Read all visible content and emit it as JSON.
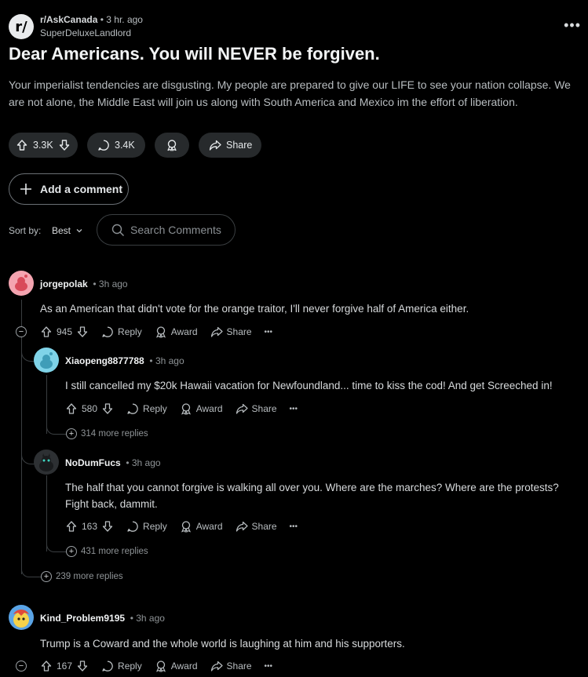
{
  "post": {
    "subreddit_avatar": "r/",
    "subreddit": "r/AskCanada",
    "time": "3 hr. ago",
    "author": "SuperDeluxeLandlord",
    "title": "Dear Americans. You will NEVER be forgiven.",
    "body": "Your imperialist tendencies are disgusting. My people are prepared to give our LIFE to see your nation collapse. We are not alone, the Middle East will join us along with South America and Mexico im the effort of liberation.",
    "votes": "3.3K",
    "comments": "3.4K",
    "share_label": "Share",
    "more_label": "•••"
  },
  "add_comment_label": "Add a comment",
  "sort": {
    "label": "Sort by:",
    "value": "Best"
  },
  "search": {
    "placeholder": "Search Comments"
  },
  "comments": [
    {
      "author": "jorgepolak",
      "time": "3h ago",
      "text": "As an American that didn't vote for the orange traitor, I'll never forgive half of America either.",
      "votes": "945",
      "reply_label": "Reply",
      "award_label": "Award",
      "share_label": "Share",
      "more_label": "•••",
      "replies": [
        {
          "author": "Xiaopeng8877788",
          "time": "3h ago",
          "text": "I still cancelled my $20k Hawaii vacation for Newfoundland... time to kiss the cod! And get Screeched in!",
          "votes": "580",
          "more_replies": "314 more replies"
        },
        {
          "author": "NoDumFucs",
          "time": "3h ago",
          "text": "The half that you cannot forgive is walking all over you. Where are the marches? Where are the protests? Fight back, dammit.",
          "votes": "163",
          "more_replies": "431 more replies"
        }
      ],
      "more_replies": "239 more replies"
    },
    {
      "author": "Kind_Problem9195",
      "time": "3h ago",
      "text": "Trump is a Coward and the whole world is laughing at him and his supporters.",
      "votes": "167"
    }
  ],
  "colors": {
    "background": "#000000",
    "pill": "#272a2c",
    "text": "#d7dadc"
  }
}
